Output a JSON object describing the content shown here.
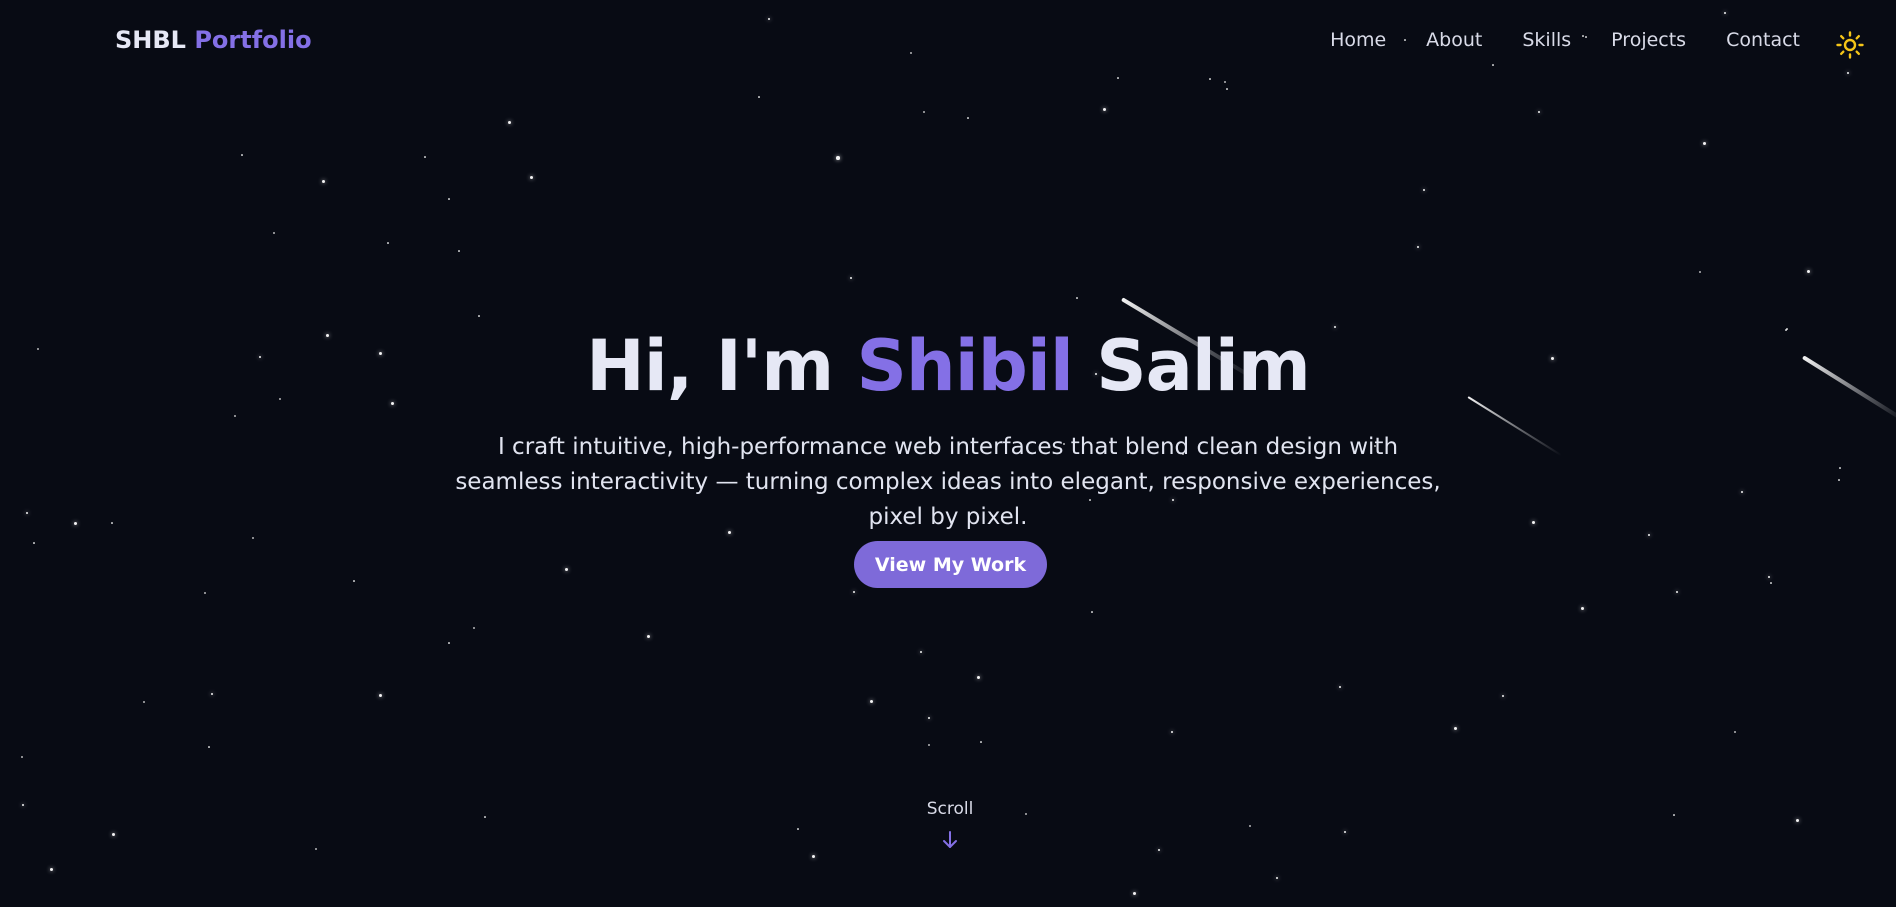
{
  "header": {
    "logo_main": "SHBL",
    "logo_accent": "Portfolio",
    "nav": [
      {
        "label": "Home"
      },
      {
        "label": "About"
      },
      {
        "label": "Skills"
      },
      {
        "label": "Projects"
      },
      {
        "label": "Contact"
      }
    ],
    "theme_toggle_icon": "sun-icon"
  },
  "hero": {
    "greeting": "Hi, I'm",
    "first_name": "Shibil",
    "last_name": "Salim",
    "tagline": "I craft intuitive, high-performance web interfaces that blend clean design with seamless interactivity — turning complex ideas into elegant, responsive experiences, pixel by pixel.",
    "cta_label": "View My Work"
  },
  "scroll_hint": {
    "label": "Scroll",
    "icon": "arrow-down-icon"
  },
  "colors": {
    "background": "#080b14",
    "accent": "#8470e6",
    "button": "#7e6ad9",
    "text": "#e6e8f5",
    "sun": "#f5c518"
  }
}
